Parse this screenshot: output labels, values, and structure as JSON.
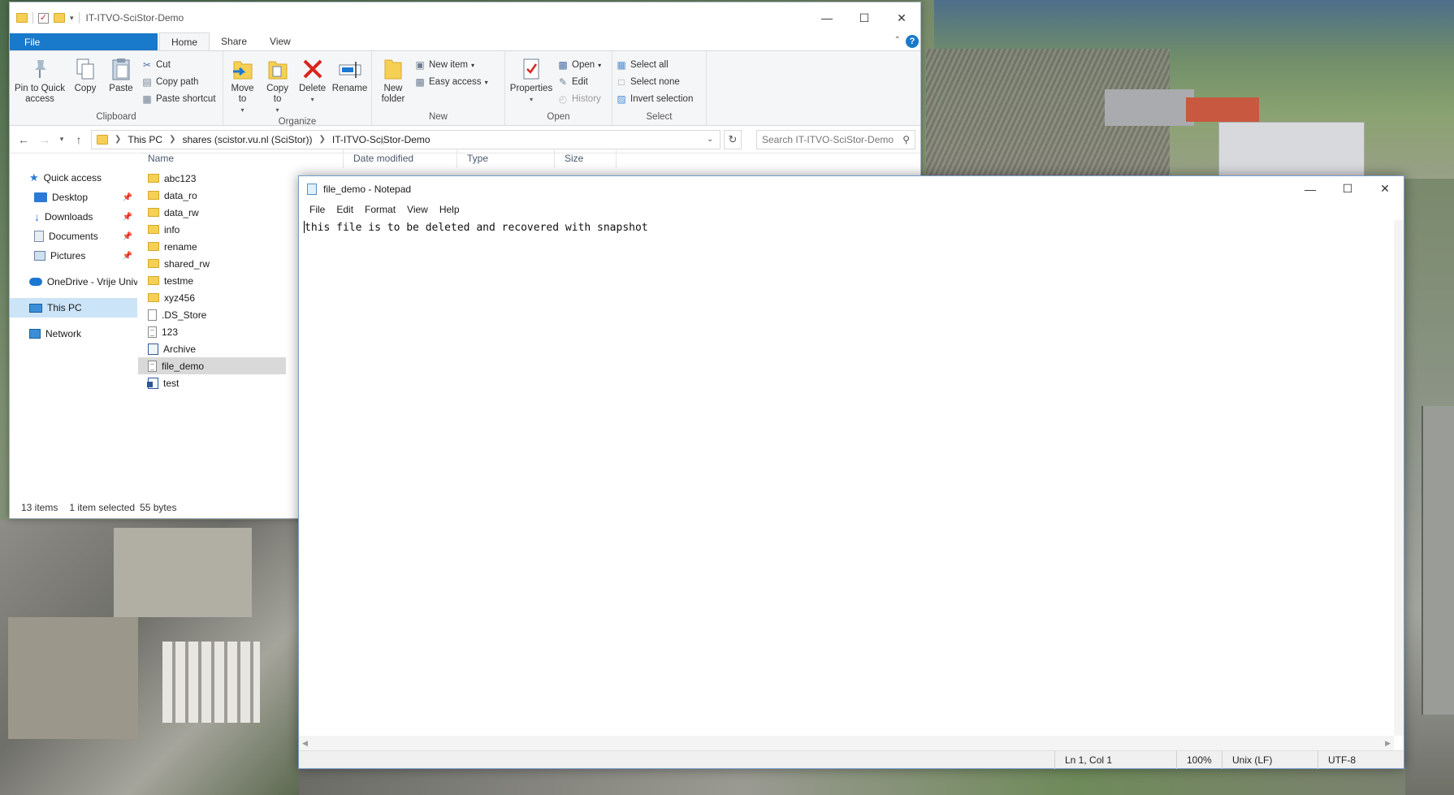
{
  "colors": {
    "accent": "#1979ca",
    "selection": "#cce4f7",
    "folder": "#f6cf55",
    "delete_red": "#d9241c"
  },
  "explorer": {
    "title": "IT-ITVO-SciStor-Demo",
    "tabs": [
      "File",
      "Home",
      "Share",
      "View"
    ],
    "ribbon": {
      "clipboard": {
        "label": "Clipboard",
        "pin": "Pin to Quick access",
        "copy": "Copy",
        "paste": "Paste",
        "cut": "Cut",
        "copy_path": "Copy path",
        "paste_shortcut": "Paste shortcut"
      },
      "organize": {
        "label": "Organize",
        "move_to": "Move to",
        "copy_to": "Copy to",
        "delete": "Delete",
        "rename": "Rename"
      },
      "new": {
        "label": "New",
        "new_folder": "New folder",
        "new_item": "New item",
        "easy_access": "Easy access"
      },
      "open": {
        "label": "Open",
        "properties": "Properties",
        "open": "Open",
        "edit": "Edit",
        "history": "History"
      },
      "select": {
        "label": "Select",
        "select_all": "Select all",
        "select_none": "Select none",
        "invert": "Invert selection"
      }
    },
    "address": {
      "crumbs": [
        "This PC",
        "shares (scistor.vu.nl (SciStor))",
        "IT-ITVO-SciStor-Demo"
      ],
      "search_placeholder": "Search IT-ITVO-SciStor-Demo"
    },
    "nav": {
      "quick_access": "Quick access",
      "desktop": "Desktop",
      "downloads": "Downloads",
      "documents": "Documents",
      "pictures": "Pictures",
      "onedrive": "OneDrive - Vrije Univ",
      "this_pc": "This PC",
      "network": "Network"
    },
    "columns": {
      "name": "Name",
      "date": "Date modified",
      "type": "Type",
      "size": "Size"
    },
    "files": [
      {
        "name": "abc123",
        "kind": "folder"
      },
      {
        "name": "data_ro",
        "kind": "folder"
      },
      {
        "name": "data_rw",
        "kind": "folder"
      },
      {
        "name": "info",
        "kind": "folder"
      },
      {
        "name": "rename",
        "kind": "folder"
      },
      {
        "name": "shared_rw",
        "kind": "folder"
      },
      {
        "name": "testme",
        "kind": "folder"
      },
      {
        "name": "xyz456",
        "kind": "folder"
      },
      {
        "name": ".DS_Store",
        "kind": "file"
      },
      {
        "name": "123",
        "kind": "text"
      },
      {
        "name": "Archive",
        "kind": "archive"
      },
      {
        "name": "file_demo",
        "kind": "text",
        "selected": true
      },
      {
        "name": "test",
        "kind": "word"
      }
    ],
    "status": {
      "count": "13 items",
      "selected": "1 item selected",
      "size": "55 bytes"
    }
  },
  "notepad": {
    "title": "file_demo - Notepad",
    "menu": [
      "File",
      "Edit",
      "Format",
      "View",
      "Help"
    ],
    "content": "this file is to be deleted and recovered with snapshot",
    "status": {
      "position": "Ln 1, Col 1",
      "zoom": "100%",
      "line_ending": "Unix (LF)",
      "encoding": "UTF-8"
    }
  }
}
